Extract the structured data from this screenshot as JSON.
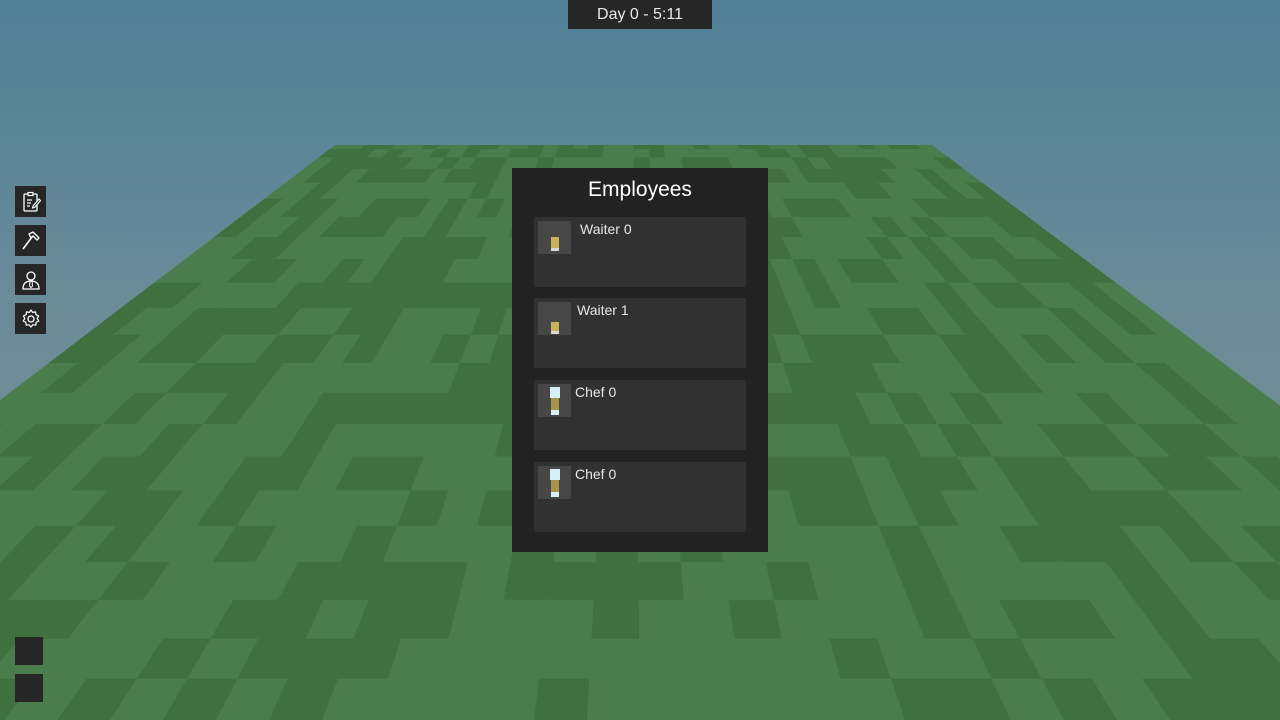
{
  "hud": {
    "clock": "Day 0 - 5:11"
  },
  "toolbar": {
    "items": [
      {
        "name": "clipboard-icon"
      },
      {
        "name": "hammer-icon"
      },
      {
        "name": "employee-icon"
      },
      {
        "name": "gear-icon"
      }
    ]
  },
  "panel": {
    "title": "Employees",
    "employees": [
      {
        "name": "Waiter 0",
        "role": "waiter"
      },
      {
        "name": "Waiter 1",
        "role": "waiter"
      },
      {
        "name": "Chef 0",
        "role": "chef"
      },
      {
        "name": "Chef 0",
        "role": "chef"
      }
    ]
  },
  "colors": {
    "panel_bg": "#222222",
    "card_bg": "#313131",
    "grass_light": "#4b7d4c",
    "grass_dark": "#41703f",
    "sky_top": "#4f7f96",
    "uniform_gold": "#c9b25a",
    "chef_hat": "#d6f0f7"
  }
}
